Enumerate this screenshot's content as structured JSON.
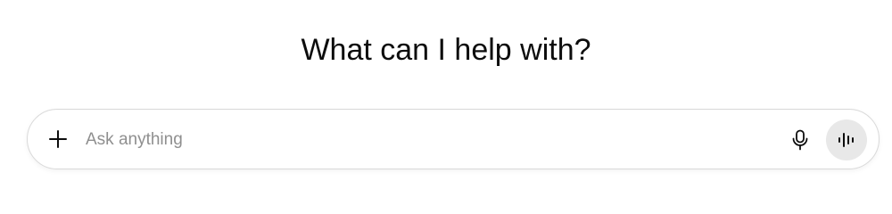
{
  "heading": {
    "text": "What can I help with?"
  },
  "composer": {
    "placeholder": "Ask anything",
    "value": ""
  },
  "icons": {
    "attach": "plus-icon",
    "dictate": "microphone-icon",
    "voice_mode": "audio-waveform-icon"
  },
  "colors": {
    "text": "#0d0d0d",
    "placeholder": "#8f8f8f",
    "border": "#d9d9d9",
    "voice_button_bg": "#e8e8e8"
  }
}
